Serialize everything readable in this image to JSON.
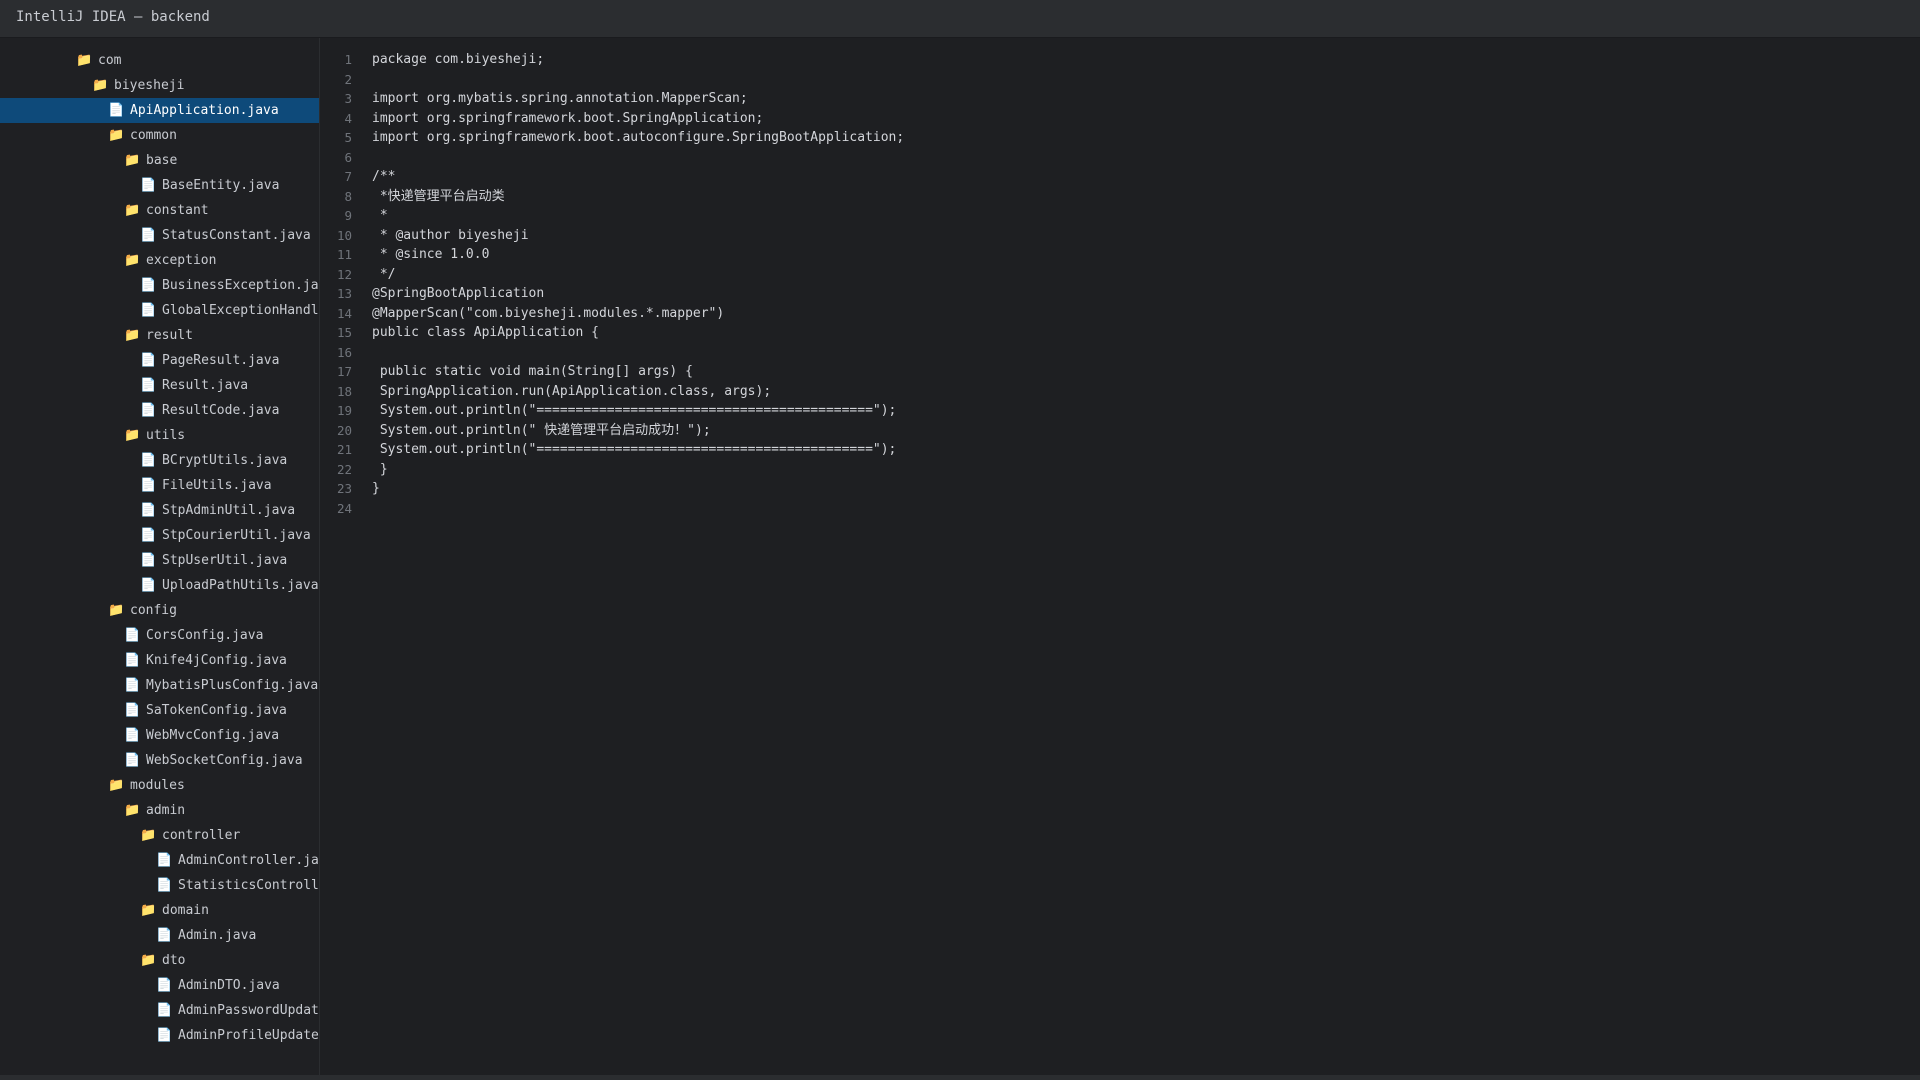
{
  "window": {
    "title": "IntelliJ IDEA — backend"
  },
  "icons": {
    "folder": "📁",
    "file": "📄"
  },
  "colors": {
    "selection": "#0e4a7a",
    "folder_icon": "#e6b35a",
    "background": "#1e1f22"
  },
  "project_tree": [
    {
      "label": "com",
      "type": "folder",
      "depth": 0
    },
    {
      "label": "biyesheji",
      "type": "folder",
      "depth": 1
    },
    {
      "label": "ApiApplication.java",
      "type": "file",
      "depth": 2,
      "selected": true
    },
    {
      "label": "common",
      "type": "folder",
      "depth": 2
    },
    {
      "label": "base",
      "type": "folder",
      "depth": 3
    },
    {
      "label": "BaseEntity.java",
      "type": "file",
      "depth": 4
    },
    {
      "label": "constant",
      "type": "folder",
      "depth": 3
    },
    {
      "label": "StatusConstant.java",
      "type": "file",
      "depth": 4
    },
    {
      "label": "exception",
      "type": "folder",
      "depth": 3
    },
    {
      "label": "BusinessException.java",
      "type": "file",
      "depth": 4
    },
    {
      "label": "GlobalExceptionHandler.java",
      "type": "file",
      "depth": 4
    },
    {
      "label": "result",
      "type": "folder",
      "depth": 3
    },
    {
      "label": "PageResult.java",
      "type": "file",
      "depth": 4
    },
    {
      "label": "Result.java",
      "type": "file",
      "depth": 4
    },
    {
      "label": "ResultCode.java",
      "type": "file",
      "depth": 4
    },
    {
      "label": "utils",
      "type": "folder",
      "depth": 3
    },
    {
      "label": "BCryptUtils.java",
      "type": "file",
      "depth": 4
    },
    {
      "label": "FileUtils.java",
      "type": "file",
      "depth": 4
    },
    {
      "label": "StpAdminUtil.java",
      "type": "file",
      "depth": 4
    },
    {
      "label": "StpCourierUtil.java",
      "type": "file",
      "depth": 4
    },
    {
      "label": "StpUserUtil.java",
      "type": "file",
      "depth": 4
    },
    {
      "label": "UploadPathUtils.java",
      "type": "file",
      "depth": 4
    },
    {
      "label": "config",
      "type": "folder",
      "depth": 2
    },
    {
      "label": "CorsConfig.java",
      "type": "file",
      "depth": 3
    },
    {
      "label": "Knife4jConfig.java",
      "type": "file",
      "depth": 3
    },
    {
      "label": "MybatisPlusConfig.java",
      "type": "file",
      "depth": 3
    },
    {
      "label": "SaTokenConfig.java",
      "type": "file",
      "depth": 3
    },
    {
      "label": "WebMvcConfig.java",
      "type": "file",
      "depth": 3
    },
    {
      "label": "WebSocketConfig.java",
      "type": "file",
      "depth": 3
    },
    {
      "label": "modules",
      "type": "folder",
      "depth": 2
    },
    {
      "label": "admin",
      "type": "folder",
      "depth": 3
    },
    {
      "label": "controller",
      "type": "folder",
      "depth": 4
    },
    {
      "label": "AdminController.java",
      "type": "file",
      "depth": 5
    },
    {
      "label": "StatisticsController.java",
      "type": "file",
      "depth": 5
    },
    {
      "label": "domain",
      "type": "folder",
      "depth": 4
    },
    {
      "label": "Admin.java",
      "type": "file",
      "depth": 5
    },
    {
      "label": "dto",
      "type": "folder",
      "depth": 4
    },
    {
      "label": "AdminDTO.java",
      "type": "file",
      "depth": 5
    },
    {
      "label": "AdminPasswordUpdateDTO.java",
      "type": "file",
      "depth": 5
    },
    {
      "label": "AdminProfileUpdateDTO.java",
      "type": "file",
      "depth": 5
    }
  ],
  "editor": {
    "lines": [
      {
        "n": "1",
        "text": "package com.biyesheji;"
      },
      {
        "n": "2",
        "text": ""
      },
      {
        "n": "3",
        "text": "import org.mybatis.spring.annotation.MapperScan;"
      },
      {
        "n": "4",
        "text": "import org.springframework.boot.SpringApplication;"
      },
      {
        "n": "5",
        "text": "import org.springframework.boot.autoconfigure.SpringBootApplication;"
      },
      {
        "n": "6",
        "text": ""
      },
      {
        "n": "7",
        "text": "/**"
      },
      {
        "n": "8",
        "text": " *快递管理平台启动类"
      },
      {
        "n": "9",
        "text": " *"
      },
      {
        "n": "10",
        "text": " * @author biyesheji"
      },
      {
        "n": "11",
        "text": " * @since 1.0.0"
      },
      {
        "n": "12",
        "text": " */"
      },
      {
        "n": "13",
        "text": "@SpringBootApplication"
      },
      {
        "n": "14",
        "text": "@MapperScan(\"com.biyesheji.modules.*.mapper\")"
      },
      {
        "n": "15",
        "text": "public class ApiApplication {"
      },
      {
        "n": "16",
        "text": ""
      },
      {
        "n": "17",
        "text": " public static void main(String[] args) {"
      },
      {
        "n": "18",
        "text": " SpringApplication.run(ApiApplication.class, args);"
      },
      {
        "n": "19",
        "text": " System.out.println(\"===========================================\");"
      },
      {
        "n": "20",
        "text": " System.out.println(\" 快递管理平台启动成功！\");"
      },
      {
        "n": "21",
        "text": " System.out.println(\"===========================================\");"
      },
      {
        "n": "22",
        "text": " }"
      },
      {
        "n": "23",
        "text": "}"
      },
      {
        "n": "24",
        "text": ""
      }
    ]
  }
}
